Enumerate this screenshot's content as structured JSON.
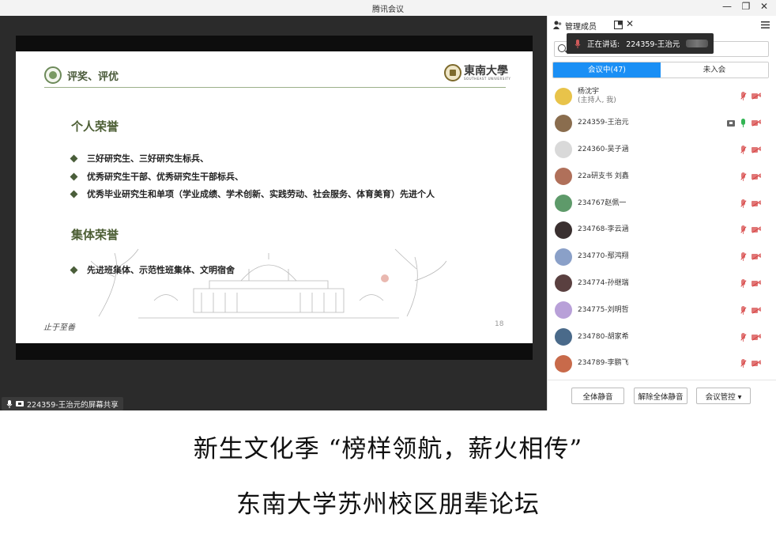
{
  "window": {
    "title": "腾讯会议",
    "minimize_icon": "—",
    "restore_icon": "❐",
    "close_icon": "✕"
  },
  "slide": {
    "header_title": "评奖、评优",
    "logo_text": "東南大學",
    "logo_sub": "SOUTHEAST UNIVERSITY",
    "sections": [
      {
        "title": "个人荣誉",
        "items": [
          "三好研究生、三好研究生标兵、",
          "优秀研究生干部、优秀研究生干部标兵、",
          "优秀毕业研究生和单项（学业成绩、学术创新、实践劳动、社会服务、体育美育）先进个人"
        ]
      },
      {
        "title": "集体荣誉",
        "items": [
          "先进班集体、示范性班集体、文明宿舍"
        ]
      }
    ],
    "motto": "止于至善",
    "page_number": "18"
  },
  "share_label": "224359-王治元的屏幕共享",
  "panel": {
    "title": "管理成员",
    "speaking_label": "正在讲话:",
    "speaking_name": "224359-王治元",
    "tabs": [
      {
        "label": "会议中(47)",
        "active": true
      },
      {
        "label": "未入会",
        "active": false
      }
    ],
    "members": [
      {
        "name": "杨沈宇",
        "sub": "(主持人, 我)",
        "avatar_color": "#e8c34a",
        "mic_on": false,
        "sharing": false
      },
      {
        "name": "224359-王治元",
        "sub": "",
        "avatar_color": "#8a6d4e",
        "mic_on": true,
        "sharing": true
      },
      {
        "name": "224360-吴子涵",
        "sub": "",
        "avatar_color": "#d9d9d9",
        "mic_on": false,
        "sharing": false
      },
      {
        "name": "22a研支书 刘鑫",
        "sub": "",
        "avatar_color": "#b0705a",
        "mic_on": false,
        "sharing": false
      },
      {
        "name": "234767赵佩一",
        "sub": "",
        "avatar_color": "#5e9a6a",
        "mic_on": false,
        "sharing": false
      },
      {
        "name": "234768-李云涵",
        "sub": "",
        "avatar_color": "#3a3030",
        "mic_on": false,
        "sharing": false
      },
      {
        "name": "234770-鄢鸿翔",
        "sub": "",
        "avatar_color": "#8aa0c8",
        "mic_on": false,
        "sharing": false
      },
      {
        "name": "234774-孙继瑞",
        "sub": "",
        "avatar_color": "#5a4040",
        "mic_on": false,
        "sharing": false
      },
      {
        "name": "234775-刘明哲",
        "sub": "",
        "avatar_color": "#b8a0d8",
        "mic_on": false,
        "sharing": false
      },
      {
        "name": "234780-胡家希",
        "sub": "",
        "avatar_color": "#4a6a8a",
        "mic_on": false,
        "sharing": false
      },
      {
        "name": "234789-李鹏飞",
        "sub": "",
        "avatar_color": "#c86a4a",
        "mic_on": false,
        "sharing": false
      }
    ],
    "footer": {
      "mute_all": "全体静音",
      "unmute_all": "解除全体静音",
      "controls": "会议管控 ▾"
    }
  },
  "captions": {
    "line1": "新生文化季 “榜样领航，薪火相传”",
    "line2": "东南大学苏州校区朋辈论坛"
  },
  "colors": {
    "accent": "#1a8ff5",
    "slide_green": "#4c5e34",
    "muted_red": "#e07777",
    "active_green": "#33b553"
  }
}
